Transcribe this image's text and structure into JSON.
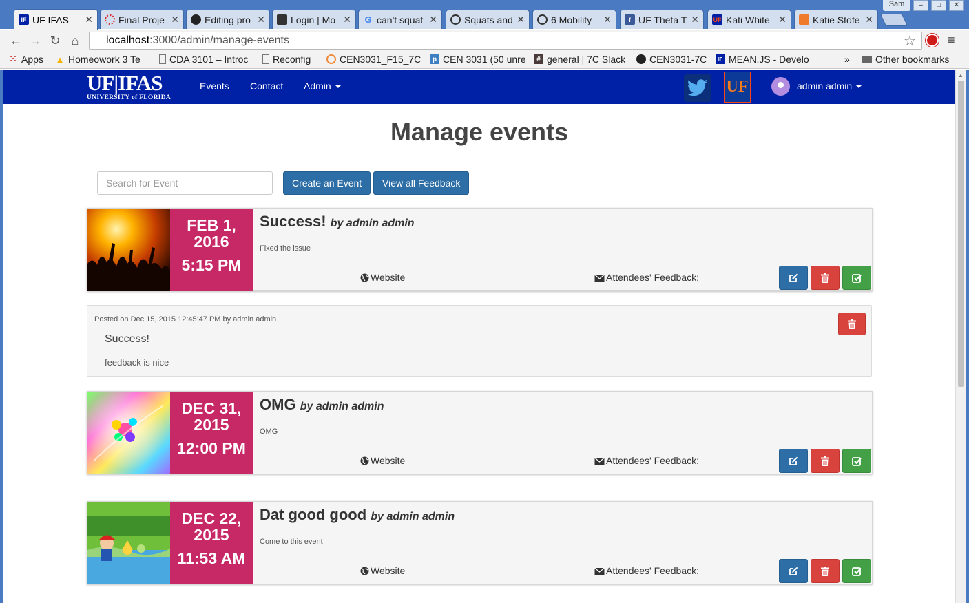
{
  "browser": {
    "tabs": [
      {
        "title": "UF IFAS",
        "active": true
      },
      {
        "title": "Final Proje",
        "active": false
      },
      {
        "title": "Editing pro",
        "active": false
      },
      {
        "title": "Login | Mo",
        "active": false
      },
      {
        "title": "can't squat",
        "active": false
      },
      {
        "title": "Squats and",
        "active": false
      },
      {
        "title": "6 Mobility",
        "active": false
      },
      {
        "title": "UF Theta T",
        "active": false
      },
      {
        "title": "Kati White",
        "active": false
      },
      {
        "title": "Katie Stofe",
        "active": false
      }
    ],
    "profile": "Sam",
    "url_host": "localhost",
    "url_path": ":3000/admin/manage-events",
    "bookmarks": [
      "Apps",
      "Homeowork 3 Te",
      "CDA 3101 – Introc",
      "Reconfig",
      "CEN3031_F15_7C",
      "CEN 3031 (50 unre",
      "general | 7C Slack",
      "CEN3031-7C",
      "MEAN.JS - Develo"
    ],
    "bookmarks_overflow": "»",
    "other_bookmarks": "Other bookmarks"
  },
  "site": {
    "logo_main": "UF|IFAS",
    "logo_sub": "UNIVERSITY of FLORIDA",
    "nav": {
      "events": "Events",
      "contact": "Contact",
      "admin": "Admin"
    },
    "user": "admin admin",
    "colors": {
      "navbar": "#0021a5",
      "date_block": "#c72866",
      "primary": "#2c6ea5",
      "danger": "#d9433e",
      "success": "#43a047"
    }
  },
  "page": {
    "title": "Manage events",
    "search_placeholder": "Search for Event",
    "create_button": "Create an Event",
    "feedback_button": "View all Feedback"
  },
  "labels": {
    "by": "by",
    "website": "Website",
    "attendees_feedback": "Attendees' Feedback:"
  },
  "events": [
    {
      "date": "FEB 1, 2016",
      "date_line1": "FEB 1,",
      "date_line2": "2016",
      "time": "5:15 PM",
      "title": "Success!",
      "author": "admin admin",
      "description": "Fixed the issue"
    },
    {
      "date": "DEC 31, 2015",
      "date_line1": "DEC 31,",
      "date_line2": "2015",
      "time": "12:00 PM",
      "title": "OMG",
      "author": "admin admin",
      "description": "OMG"
    },
    {
      "date": "DEC 22, 2015",
      "date_line1": "DEC 22,",
      "date_line2": "2015",
      "time": "11:53 AM",
      "title": "Dat good good",
      "author": "admin admin",
      "description": "Come to this event"
    }
  ],
  "feedback": {
    "meta": "Posted on Dec 15, 2015 12:45:47 PM by admin admin",
    "title": "Success!",
    "body": "feedback is nice"
  }
}
